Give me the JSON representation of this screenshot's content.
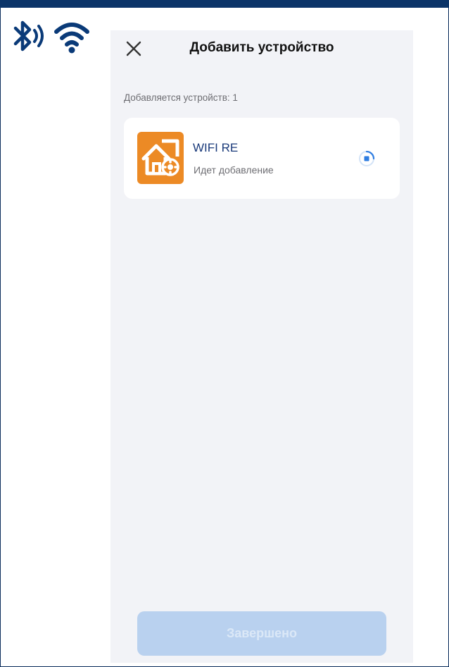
{
  "colors": {
    "top_band": "#0b3468",
    "icon_blue": "#0a3a78",
    "device_icon_bg": "#ec8a25",
    "device_name": "#1a3a7a",
    "spinner": "#2f7de1",
    "done_button_bg": "#b9d1ef"
  },
  "status_icons": [
    "bluetooth-icon",
    "wifi-icon"
  ],
  "header": {
    "title": "Добавить устройство",
    "close_icon": "close-icon"
  },
  "subtitle": "Добавляется устройств: 1",
  "device": {
    "name": "WIFI RE",
    "status": "Идет добавление",
    "icon": "smart-home-gear-icon",
    "progress_icon": "loading-spinner-icon"
  },
  "footer": {
    "done_label": "Завершено",
    "done_enabled": false
  }
}
